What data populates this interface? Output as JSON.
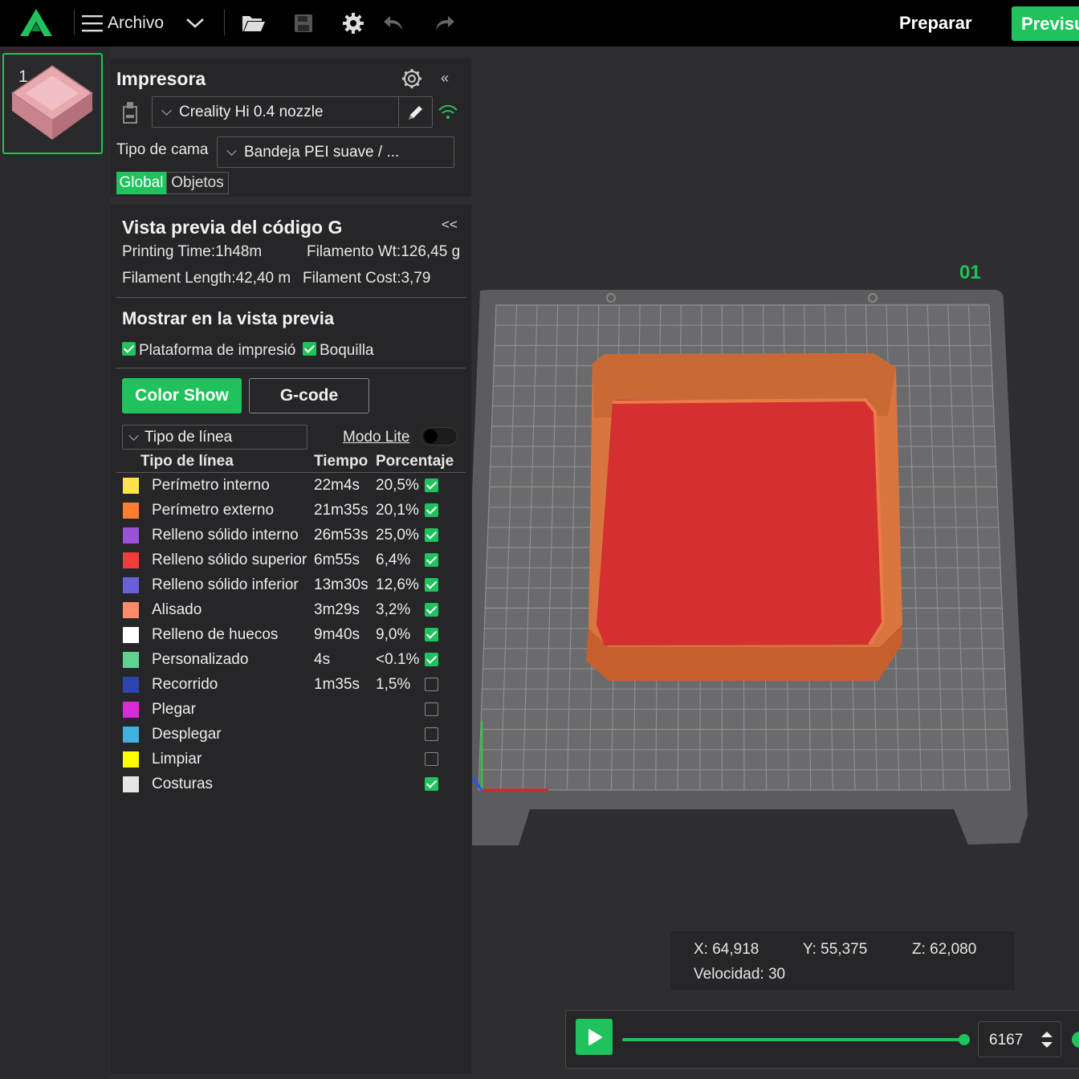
{
  "topbar": {
    "menu_label": "Archivo",
    "prepare_label": "Preparar",
    "preview_label": "Previsu",
    "accent": "#1fc25c"
  },
  "plate_thumb": {
    "number": "1"
  },
  "printer": {
    "title": "Impresora",
    "printer_name": "Creality Hi 0.4 nozzle",
    "bed_label": "Tipo de cama",
    "bed_value": "Bandeja PEI suave / ...",
    "tab_global": "Global",
    "tab_objects": "Objetos"
  },
  "gcode": {
    "title": "Vista previa del código G",
    "printing_time": "Printing Time:1h48m",
    "filament_wt": "Filamento Wt:126,45 g",
    "filament_length": "Filament Length:42,40 m",
    "filament_cost": "Filament Cost:3,79",
    "show_title": "Mostrar en la vista previa",
    "opt_plate": "Plataforma de impresió",
    "opt_nozzle": "Boquilla",
    "btn_color_show": "Color Show",
    "btn_gcode": "G-code",
    "view_type": "Tipo de línea",
    "lite_mode": "Modo Lite",
    "col_type": "Tipo de línea",
    "col_time": "Tiempo",
    "col_pct": "Porcentaje",
    "rows": [
      {
        "name": "Perímetro interno",
        "time": "22m4s",
        "pct": "20,5%",
        "color": "#ffe14a",
        "checked": true
      },
      {
        "name": "Perímetro externo",
        "time": "21m35s",
        "pct": "20,1%",
        "color": "#ff7f2e",
        "checked": true
      },
      {
        "name": "Relleno sólido interno",
        "time": "26m53s",
        "pct": "25,0%",
        "color": "#9a52d8",
        "checked": true
      },
      {
        "name": "Relleno sólido superior",
        "time": "6m55s",
        "pct": "6,4%",
        "color": "#f23b3b",
        "checked": true
      },
      {
        "name": "Relleno sólido inferior",
        "time": "13m30s",
        "pct": "12,6%",
        "color": "#6a5fd8",
        "checked": true
      },
      {
        "name": "Alisado",
        "time": "3m29s",
        "pct": "3,2%",
        "color": "#ff8a6a",
        "checked": true
      },
      {
        "name": "Relleno de huecos",
        "time": "9m40s",
        "pct": "9,0%",
        "color": "#ffffff",
        "checked": true
      },
      {
        "name": "Personalizado",
        "time": "4s",
        "pct": "<0.1%",
        "color": "#5fd28f",
        "checked": true
      },
      {
        "name": "Recorrido",
        "time": "1m35s",
        "pct": "1,5%",
        "color": "#2e45b0",
        "checked": false
      },
      {
        "name": "Plegar",
        "time": "",
        "pct": "",
        "color": "#d82ad8",
        "checked": false
      },
      {
        "name": "Desplegar",
        "time": "",
        "pct": "",
        "color": "#3fb1dc",
        "checked": false
      },
      {
        "name": "Limpiar",
        "time": "",
        "pct": "",
        "color": "#ffff00",
        "checked": false
      },
      {
        "name": "Costuras",
        "time": "",
        "pct": "",
        "color": "#e6e6e6",
        "checked": true
      }
    ]
  },
  "viewport": {
    "plate_label": "01",
    "x": "X: 64,918",
    "y": "Y: 55,375",
    "z": "Z: 62,080",
    "speed": "Velocidad: 30",
    "layer_value": "6167"
  }
}
